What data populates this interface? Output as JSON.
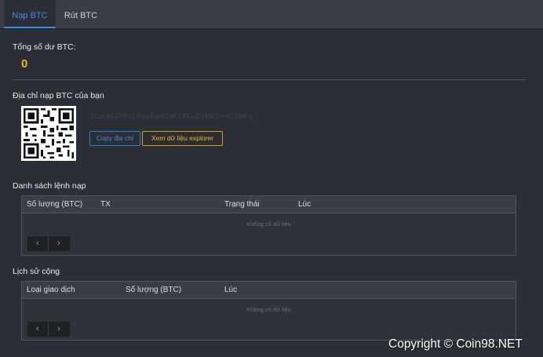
{
  "tabs": [
    {
      "label": "Nạp BTC",
      "active": true
    },
    {
      "label": "Rút BTC",
      "active": false
    }
  ],
  "balance": {
    "label": "Tổng số dư BTC:",
    "value": "0"
  },
  "deposit": {
    "label": "Địa chỉ nạp BTC của bạn",
    "address": "1Lacu5Z9Xn1KewKwKcaK1XGcEVh5SmeE3mKq",
    "copy_label": "Copy địa chỉ",
    "explorer_label": "Xem dữ liệu explorer"
  },
  "deposit_list": {
    "title": "Danh sách lệnh nạp",
    "columns": [
      "Số lượng (BTC)",
      "TX",
      "Trạng thái",
      "Lúc"
    ],
    "empty_text": "Không có dữ liệu",
    "prev_icon": "chevron-left-icon",
    "next_icon": "chevron-right-icon"
  },
  "bonus_history": {
    "title": "Lịch sử cộng",
    "columns": [
      "Loại giao dịch",
      "Số lượng (BTC)",
      "Lúc"
    ],
    "empty_text": "Không có dữ liệu",
    "prev_icon": "chevron-left-icon",
    "next_icon": "chevron-right-icon"
  },
  "watermark": "Copyright © Coin98.NET",
  "colors": {
    "accent": "#3d8ce6",
    "gold": "#f2b61c",
    "background": "#2b2e35"
  }
}
